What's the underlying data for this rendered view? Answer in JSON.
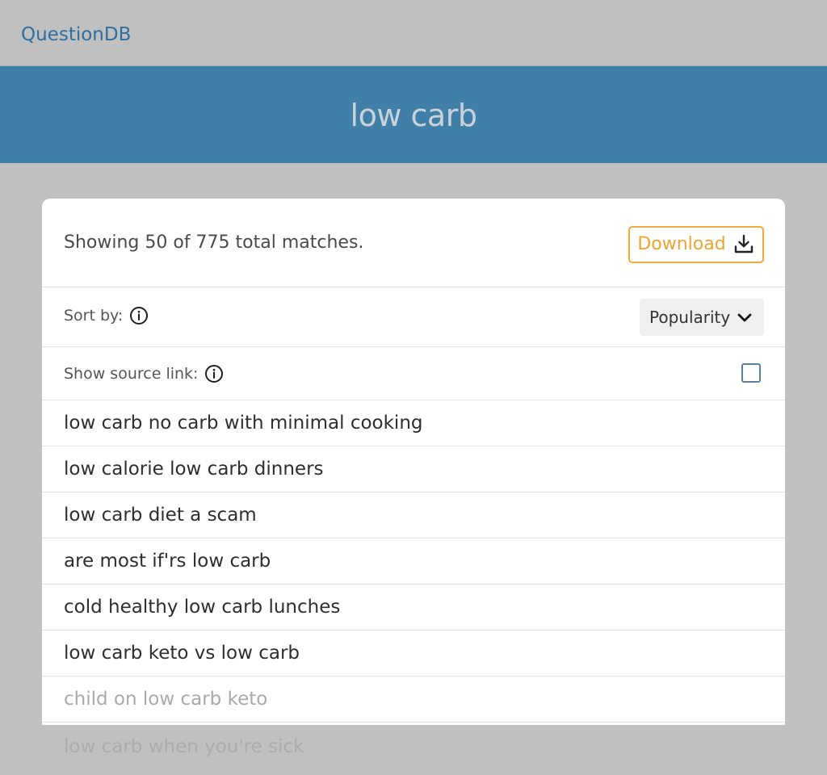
{
  "header": {
    "brand": "QuestionDB"
  },
  "hero": {
    "title": "low carb"
  },
  "summary": {
    "text": "Showing 50 of 775 total matches.",
    "download_label": "Download",
    "download_icon": "download-icon",
    "accent_color": "#f0a32f"
  },
  "sort": {
    "label": "Sort by:",
    "info_icon": "info-icon",
    "selected": "Popularity",
    "dropdown_icon": "chevron-down-icon"
  },
  "source_link": {
    "label": "Show source link:",
    "info_icon": "info-icon",
    "checked": false
  },
  "results": [
    "low carb no carb with minimal cooking",
    "low calorie low carb dinners",
    "low carb diet a scam",
    "are most if'rs low carb",
    "cold healthy low carb lunches",
    "low carb keto vs low carb",
    "child on low carb keto"
  ],
  "outside_result": "low carb when you're sick",
  "colors": {
    "hero_background": "#3f7fa8",
    "brand": "#2f6f9f",
    "page_background": "#c0c0c0"
  }
}
